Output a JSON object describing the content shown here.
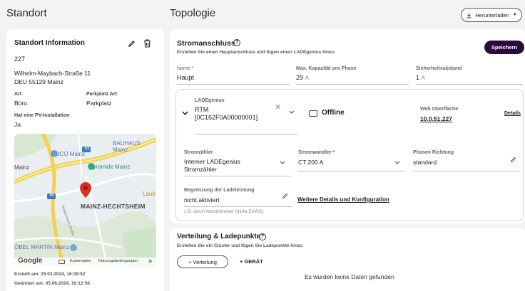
{
  "left": {
    "heading": "Standort",
    "card_title": "Standort Information",
    "site_id": "227",
    "street": "Wilhelm-Maybach-Straße 11",
    "city": "DEU 55129 Mainz",
    "art_label": "Art",
    "art_value": "Büro",
    "parking_label": "Parkplatz Art",
    "parking_value": "Parkplatz",
    "pv_label": "Hat eine PV-Installation",
    "pv_value": "Ja",
    "created": "Erstellt am: 25.03.2024, 16:39:52",
    "changed": "Geändert am: 05.06.2024, 10:12:56"
  },
  "map": {
    "bauhaus": "BAUHAUS Mainz",
    "poco": "POCO Mainz",
    "mainz": "Mainz",
    "pyramide": "Pyramide Mainz",
    "hechtsheim": "MAINZ-HECHTSHEIM",
    "laub": "Laub",
    "obel": "ÖBEL MARTIN Mainz",
    "road": "Robert-Koch-Straße",
    "google": "Google",
    "kartendaten": "Kartendaten",
    "nutzung": "Nutzungsbedingungen",
    "road_a60": "60",
    "road_b": "63"
  },
  "topo": {
    "heading": "Topologie",
    "download_label": "Herunterladen"
  },
  "anschluss": {
    "title": "Stromanschluss",
    "subtitle": "Erstellen Sie einen Hauptanschluss und fügen einen LADEgenius hinzu",
    "save": "Speichern",
    "name_label": "Name *",
    "name_value": "Haupt",
    "max_label": "Max. Kapazität pro Phase",
    "max_value": "29",
    "max_unit": "A",
    "sicher_label": "Sicherheitsabstand",
    "sicher_value": "1",
    "sicher_unit": "A"
  },
  "ladegenius": {
    "label": "LADEgenius",
    "line1": "RTM",
    "line2": "[0C162F0A00000001]",
    "status": "Offline",
    "web_label": "Web Oberfläche",
    "web_value": "10.0.51.227",
    "details": "Details",
    "zaehler_label": "Stromzähler",
    "zaehler_value1": "Interner LADEgenius",
    "zaehler_value2": "Stromzähler",
    "wandler_label": "Stromwandler *",
    "wandler_value": "CT 200 A",
    "phasen_label": "Phasen Richtung",
    "phasen_value": "standard",
    "begrenz_label": "Begrenzung der Ladeleistung",
    "begrenz_value": "nicht aktiviert",
    "begrenz_hint": "z.B. durch Netzbetreiber (§14a EnWG)",
    "weitere": "Weitere Details und Konfiguration"
  },
  "verteilung": {
    "title": "Verteilung & Ladepunkte",
    "subtitle": "Erstellen Sie ein Cluster und fügen Sie Ladepunkte hinzu",
    "btn_verteilung": "+ Verteilung",
    "btn_geraet": "+ GERÄT",
    "empty": "Es wurden keine Daten gefunden"
  },
  "colors": {
    "accent": "#2a0a3d",
    "map_marker": "#d93025"
  }
}
